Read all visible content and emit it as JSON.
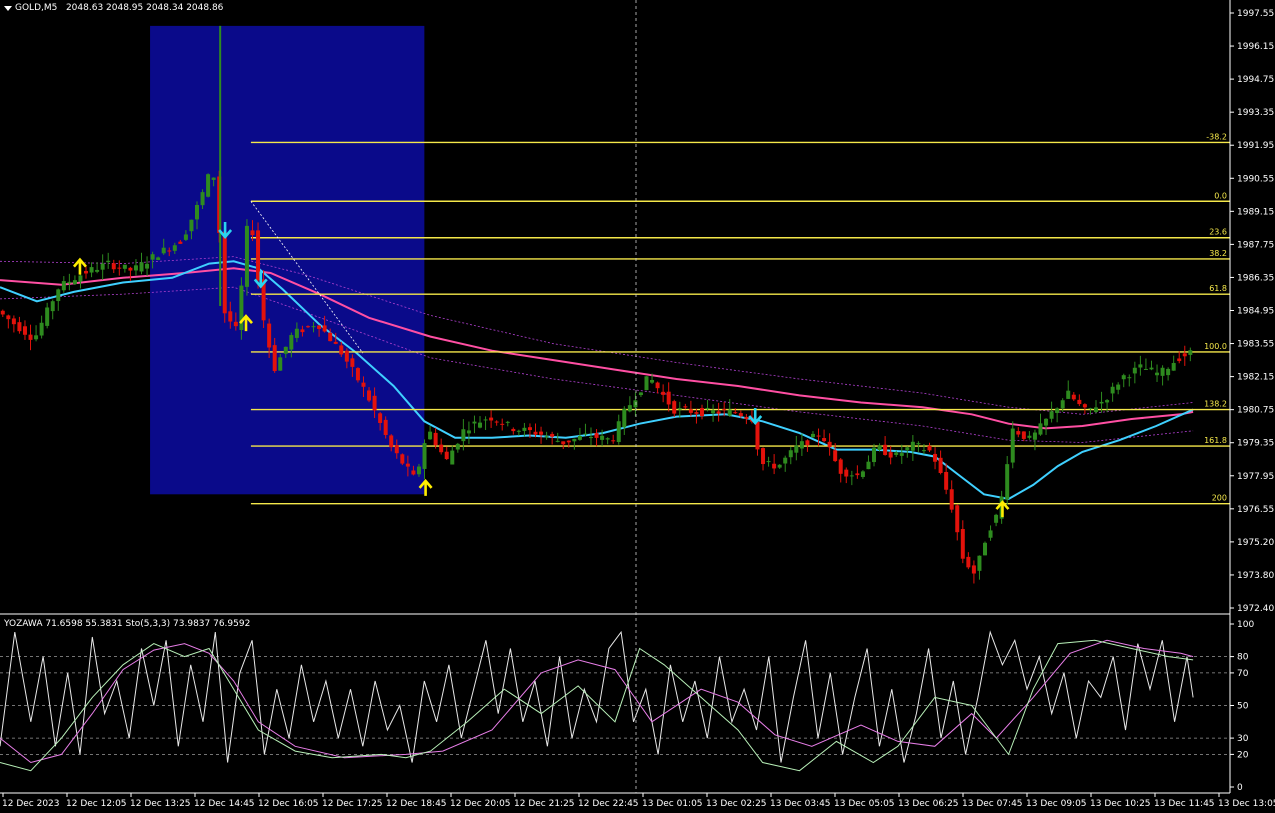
{
  "header": {
    "symbol": "GOLD,M5",
    "ohlc": "2048.63 2048.95 2048.34 2048.86"
  },
  "indicator_header": "YOZAWA 71.6598 55.3831  Sto(5,3,3) 73.9837 76.9592",
  "colors": {
    "background": "#000000",
    "bull": "#2e8b1f",
    "bear": "#e3120b",
    "zone": "#0a0a8a",
    "fib": "#f5e84a",
    "ma_fast": "#3fd0ff",
    "ma_slow": "#ff4fa3",
    "envelope": "#b040d0",
    "arrow_up": "#ffee00",
    "arrow_down": "#2ad4f0",
    "axis": "#ffffff",
    "stoch_main": "#b8f0b8",
    "stoch_signal": "#e87ee8",
    "yozawa": "#e8e8e8"
  },
  "price_axis": {
    "ticks": [
      "1997.55",
      "1996.15",
      "1994.75",
      "1993.35",
      "1991.95",
      "1990.55",
      "1989.15",
      "1987.75",
      "1986.35",
      "1984.95",
      "1983.55",
      "1982.15",
      "1980.75",
      "1979.35",
      "1977.95",
      "1976.55",
      "1975.20",
      "1973.80",
      "1972.40"
    ]
  },
  "time_axis": {
    "labels": [
      "12 Dec 2023",
      "12 Dec 12:05",
      "12 Dec 13:25",
      "12 Dec 14:45",
      "12 Dec 16:05",
      "12 Dec 17:25",
      "12 Dec 18:45",
      "12 Dec 20:05",
      "12 Dec 21:25",
      "12 Dec 22:45",
      "13 Dec 01:05",
      "13 Dec 02:25",
      "13 Dec 03:45",
      "13 Dec 05:05",
      "13 Dec 06:25",
      "13 Dec 07:45",
      "13 Dec 09:05",
      "13 Dec 10:25",
      "13 Dec 11:45",
      "13 Dec 13:05"
    ]
  },
  "indicator_axis": {
    "ticks": [
      "100",
      "80",
      "70",
      "50",
      "30",
      "20",
      "0"
    ]
  },
  "fibonacci": [
    {
      "label": "-38.2",
      "price": 1991.95
    },
    {
      "label": "0.0",
      "price": 1989.45
    },
    {
      "label": "23.6",
      "price": 1987.9
    },
    {
      "label": "38.2",
      "price": 1987.0
    },
    {
      "label": "61.8",
      "price": 1985.5
    },
    {
      "label": "100.0",
      "price": 1983.05
    },
    {
      "label": "138.2",
      "price": 1980.6
    },
    {
      "label": "161.8",
      "price": 1979.05
    },
    {
      "label": "200",
      "price": 1976.6
    }
  ],
  "chart_data": {
    "type": "bar",
    "symbol": "GOLD,M5",
    "ylim": [
      1972.0,
      1998.0
    ],
    "grid": false,
    "blue_zone": {
      "x_start": 0.122,
      "x_end": 0.345,
      "price_top": 1996.9,
      "price_bottom": 1977.0
    },
    "path_keypoints": [
      [
        0.0,
        1984.8
      ],
      [
        0.03,
        1983.6
      ],
      [
        0.05,
        1985.8
      ],
      [
        0.07,
        1986.4
      ],
      [
        0.09,
        1986.8
      ],
      [
        0.11,
        1986.5
      ],
      [
        0.13,
        1987.2
      ],
      [
        0.15,
        1987.8
      ],
      [
        0.165,
        1989.5
      ],
      [
        0.175,
        1991.0
      ],
      [
        0.18,
        1988.5
      ],
      [
        0.185,
        1984.7
      ],
      [
        0.195,
        1983.9
      ],
      [
        0.205,
        1989.3
      ],
      [
        0.215,
        1984.8
      ],
      [
        0.225,
        1982.3
      ],
      [
        0.24,
        1983.8
      ],
      [
        0.26,
        1984.3
      ],
      [
        0.28,
        1983.0
      ],
      [
        0.3,
        1981.3
      ],
      [
        0.32,
        1979.0
      ],
      [
        0.34,
        1977.6
      ],
      [
        0.35,
        1979.8
      ],
      [
        0.365,
        1978.4
      ],
      [
        0.38,
        1979.8
      ],
      [
        0.4,
        1980.3
      ],
      [
        0.42,
        1979.8
      ],
      [
        0.44,
        1979.6
      ],
      [
        0.46,
        1979.2
      ],
      [
        0.48,
        1979.5
      ],
      [
        0.5,
        1979.3
      ],
      [
        0.51,
        1980.5
      ],
      [
        0.53,
        1982.0
      ],
      [
        0.55,
        1980.6
      ],
      [
        0.57,
        1980.5
      ],
      [
        0.6,
        1980.5
      ],
      [
        0.615,
        1980.2
      ],
      [
        0.62,
        1978.3
      ],
      [
        0.635,
        1978.2
      ],
      [
        0.65,
        1979.0
      ],
      [
        0.67,
        1979.6
      ],
      [
        0.685,
        1978.0
      ],
      [
        0.7,
        1977.8
      ],
      [
        0.715,
        1979.0
      ],
      [
        0.73,
        1978.6
      ],
      [
        0.745,
        1979.1
      ],
      [
        0.76,
        1978.8
      ],
      [
        0.775,
        1976.7
      ],
      [
        0.785,
        1974.3
      ],
      [
        0.795,
        1973.6
      ],
      [
        0.805,
        1975.4
      ],
      [
        0.815,
        1976.3
      ],
      [
        0.825,
        1979.8
      ],
      [
        0.84,
        1979.3
      ],
      [
        0.855,
        1980.3
      ],
      [
        0.87,
        1981.3
      ],
      [
        0.885,
        1980.5
      ],
      [
        0.9,
        1981.0
      ],
      [
        0.915,
        1982.0
      ],
      [
        0.93,
        1982.4
      ],
      [
        0.945,
        1982.1
      ],
      [
        0.96,
        1982.8
      ],
      [
        0.97,
        1983.0
      ]
    ],
    "ma_fast_keypoints": [
      [
        0.0,
        1985.8
      ],
      [
        0.03,
        1985.2
      ],
      [
        0.06,
        1985.6
      ],
      [
        0.1,
        1986.0
      ],
      [
        0.14,
        1986.2
      ],
      [
        0.17,
        1986.8
      ],
      [
        0.19,
        1986.9
      ],
      [
        0.21,
        1986.6
      ],
      [
        0.23,
        1985.7
      ],
      [
        0.26,
        1984.2
      ],
      [
        0.29,
        1983.0
      ],
      [
        0.32,
        1981.6
      ],
      [
        0.345,
        1980.1
      ],
      [
        0.37,
        1979.4
      ],
      [
        0.4,
        1979.4
      ],
      [
        0.43,
        1979.5
      ],
      [
        0.46,
        1979.4
      ],
      [
        0.49,
        1979.6
      ],
      [
        0.52,
        1980.0
      ],
      [
        0.55,
        1980.3
      ],
      [
        0.59,
        1980.4
      ],
      [
        0.62,
        1980.1
      ],
      [
        0.65,
        1979.6
      ],
      [
        0.68,
        1978.9
      ],
      [
        0.71,
        1978.9
      ],
      [
        0.74,
        1978.8
      ],
      [
        0.76,
        1978.6
      ],
      [
        0.78,
        1977.8
      ],
      [
        0.8,
        1977.0
      ],
      [
        0.82,
        1976.8
      ],
      [
        0.84,
        1977.4
      ],
      [
        0.86,
        1978.2
      ],
      [
        0.88,
        1978.8
      ],
      [
        0.91,
        1979.3
      ],
      [
        0.94,
        1979.9
      ],
      [
        0.97,
        1980.6
      ]
    ],
    "ma_slow_keypoints": [
      [
        0.0,
        1986.1
      ],
      [
        0.05,
        1985.9
      ],
      [
        0.1,
        1986.2
      ],
      [
        0.15,
        1986.4
      ],
      [
        0.19,
        1986.6
      ],
      [
        0.22,
        1986.4
      ],
      [
        0.26,
        1985.5
      ],
      [
        0.3,
        1984.5
      ],
      [
        0.35,
        1983.7
      ],
      [
        0.4,
        1983.1
      ],
      [
        0.45,
        1982.7
      ],
      [
        0.5,
        1982.3
      ],
      [
        0.55,
        1981.9
      ],
      [
        0.6,
        1981.6
      ],
      [
        0.65,
        1981.2
      ],
      [
        0.7,
        1980.9
      ],
      [
        0.75,
        1980.7
      ],
      [
        0.79,
        1980.4
      ],
      [
        0.82,
        1980.0
      ],
      [
        0.85,
        1979.8
      ],
      [
        0.88,
        1979.9
      ],
      [
        0.92,
        1980.2
      ],
      [
        0.96,
        1980.4
      ],
      [
        0.97,
        1980.5
      ]
    ],
    "envelope_upper_keypoints": [
      [
        0.0,
        1986.9
      ],
      [
        0.1,
        1986.8
      ],
      [
        0.19,
        1987.1
      ],
      [
        0.25,
        1986.3
      ],
      [
        0.35,
        1984.6
      ],
      [
        0.45,
        1983.4
      ],
      [
        0.55,
        1982.6
      ],
      [
        0.65,
        1981.9
      ],
      [
        0.75,
        1981.3
      ],
      [
        0.82,
        1980.7
      ],
      [
        0.88,
        1980.4
      ],
      [
        0.97,
        1980.9
      ]
    ],
    "envelope_lower_keypoints": [
      [
        0.0,
        1985.3
      ],
      [
        0.1,
        1985.5
      ],
      [
        0.19,
        1985.8
      ],
      [
        0.25,
        1984.7
      ],
      [
        0.35,
        1982.8
      ],
      [
        0.45,
        1981.9
      ],
      [
        0.55,
        1981.2
      ],
      [
        0.65,
        1980.5
      ],
      [
        0.75,
        1979.9
      ],
      [
        0.82,
        1979.3
      ],
      [
        0.88,
        1979.2
      ],
      [
        0.97,
        1979.7
      ]
    ],
    "arrows": [
      {
        "type": "up",
        "x": 0.065,
        "price": 1986.8
      },
      {
        "type": "down",
        "x": 0.183,
        "price": 1988.1
      },
      {
        "type": "down",
        "x": 0.212,
        "price": 1986.0
      },
      {
        "type": "up",
        "x": 0.2,
        "price": 1984.4
      },
      {
        "type": "up",
        "x": 0.346,
        "price": 1977.4
      },
      {
        "type": "down",
        "x": 0.614,
        "price": 1980.2
      },
      {
        "type": "up",
        "x": 0.815,
        "price": 1976.5
      }
    ],
    "indicator": {
      "ylim": [
        0,
        100
      ],
      "levels": [
        80,
        70,
        50,
        30,
        20
      ],
      "stoch_main_keypoints": [
        [
          0.0,
          15
        ],
        [
          0.025,
          10
        ],
        [
          0.05,
          30
        ],
        [
          0.075,
          55
        ],
        [
          0.1,
          75
        ],
        [
          0.125,
          88
        ],
        [
          0.15,
          80
        ],
        [
          0.17,
          85
        ],
        [
          0.19,
          60
        ],
        [
          0.21,
          35
        ],
        [
          0.24,
          22
        ],
        [
          0.27,
          18
        ],
        [
          0.31,
          20
        ],
        [
          0.33,
          18
        ],
        [
          0.35,
          22
        ],
        [
          0.38,
          40
        ],
        [
          0.41,
          60
        ],
        [
          0.44,
          45
        ],
        [
          0.47,
          62
        ],
        [
          0.5,
          40
        ],
        [
          0.52,
          85
        ],
        [
          0.54,
          75
        ],
        [
          0.57,
          55
        ],
        [
          0.6,
          35
        ],
        [
          0.62,
          15
        ],
        [
          0.65,
          10
        ],
        [
          0.68,
          28
        ],
        [
          0.71,
          15
        ],
        [
          0.73,
          25
        ],
        [
          0.76,
          55
        ],
        [
          0.79,
          50
        ],
        [
          0.82,
          20
        ],
        [
          0.84,
          60
        ],
        [
          0.86,
          88
        ],
        [
          0.89,
          90
        ],
        [
          0.92,
          85
        ],
        [
          0.95,
          80
        ],
        [
          0.97,
          78
        ]
      ],
      "stoch_signal_keypoints": [
        [
          0.0,
          30
        ],
        [
          0.025,
          15
        ],
        [
          0.05,
          20
        ],
        [
          0.075,
          45
        ],
        [
          0.1,
          72
        ],
        [
          0.125,
          84
        ],
        [
          0.15,
          88
        ],
        [
          0.17,
          82
        ],
        [
          0.19,
          65
        ],
        [
          0.21,
          40
        ],
        [
          0.24,
          25
        ],
        [
          0.28,
          18
        ],
        [
          0.33,
          20
        ],
        [
          0.36,
          22
        ],
        [
          0.4,
          35
        ],
        [
          0.44,
          70
        ],
        [
          0.47,
          78
        ],
        [
          0.5,
          72
        ],
        [
          0.53,
          40
        ],
        [
          0.57,
          60
        ],
        [
          0.6,
          52
        ],
        [
          0.63,
          32
        ],
        [
          0.66,
          25
        ],
        [
          0.7,
          38
        ],
        [
          0.73,
          28
        ],
        [
          0.76,
          25
        ],
        [
          0.79,
          45
        ],
        [
          0.81,
          30
        ],
        [
          0.84,
          55
        ],
        [
          0.87,
          82
        ],
        [
          0.9,
          90
        ],
        [
          0.93,
          85
        ],
        [
          0.96,
          82
        ],
        [
          0.97,
          80
        ]
      ],
      "yozawa_keypoints": [
        [
          0.0,
          25
        ],
        [
          0.012,
          95
        ],
        [
          0.025,
          40
        ],
        [
          0.035,
          80
        ],
        [
          0.045,
          25
        ],
        [
          0.055,
          70
        ],
        [
          0.065,
          20
        ],
        [
          0.075,
          92
        ],
        [
          0.085,
          45
        ],
        [
          0.095,
          65
        ],
        [
          0.105,
          30
        ],
        [
          0.115,
          85
        ],
        [
          0.125,
          50
        ],
        [
          0.135,
          90
        ],
        [
          0.145,
          25
        ],
        [
          0.155,
          75
        ],
        [
          0.165,
          40
        ],
        [
          0.175,
          95
        ],
        [
          0.185,
          15
        ],
        [
          0.195,
          70
        ],
        [
          0.205,
          90
        ],
        [
          0.215,
          20
        ],
        [
          0.225,
          60
        ],
        [
          0.235,
          30
        ],
        [
          0.245,
          75
        ],
        [
          0.255,
          40
        ],
        [
          0.265,
          65
        ],
        [
          0.275,
          30
        ],
        [
          0.285,
          60
        ],
        [
          0.295,
          25
        ],
        [
          0.305,
          65
        ],
        [
          0.315,
          35
        ],
        [
          0.325,
          50
        ],
        [
          0.335,
          15
        ],
        [
          0.345,
          65
        ],
        [
          0.355,
          40
        ],
        [
          0.365,
          75
        ],
        [
          0.375,
          30
        ],
        [
          0.385,
          60
        ],
        [
          0.395,
          90
        ],
        [
          0.405,
          45
        ],
        [
          0.415,
          85
        ],
        [
          0.425,
          40
        ],
        [
          0.435,
          65
        ],
        [
          0.445,
          25
        ],
        [
          0.455,
          80
        ],
        [
          0.465,
          30
        ],
        [
          0.475,
          60
        ],
        [
          0.485,
          40
        ],
        [
          0.495,
          85
        ],
        [
          0.505,
          95
        ],
        [
          0.515,
          40
        ],
        [
          0.525,
          60
        ],
        [
          0.535,
          20
        ],
        [
          0.545,
          75
        ],
        [
          0.555,
          40
        ],
        [
          0.565,
          65
        ],
        [
          0.575,
          30
        ],
        [
          0.585,
          80
        ],
        [
          0.595,
          40
        ],
        [
          0.605,
          60
        ],
        [
          0.615,
          35
        ],
        [
          0.625,
          80
        ],
        [
          0.635,
          15
        ],
        [
          0.645,
          55
        ],
        [
          0.655,
          90
        ],
        [
          0.665,
          30
        ],
        [
          0.675,
          70
        ],
        [
          0.685,
          20
        ],
        [
          0.695,
          55
        ],
        [
          0.705,
          85
        ],
        [
          0.715,
          25
        ],
        [
          0.725,
          60
        ],
        [
          0.735,
          15
        ],
        [
          0.745,
          45
        ],
        [
          0.755,
          85
        ],
        [
          0.765,
          30
        ],
        [
          0.775,
          65
        ],
        [
          0.785,
          20
        ],
        [
          0.795,
          55
        ],
        [
          0.805,
          95
        ],
        [
          0.815,
          75
        ],
        [
          0.825,
          90
        ],
        [
          0.835,
          60
        ],
        [
          0.845,
          80
        ],
        [
          0.855,
          45
        ],
        [
          0.865,
          70
        ],
        [
          0.875,
          30
        ],
        [
          0.885,
          65
        ],
        [
          0.895,
          55
        ],
        [
          0.905,
          80
        ],
        [
          0.915,
          35
        ],
        [
          0.925,
          88
        ],
        [
          0.935,
          60
        ],
        [
          0.945,
          90
        ],
        [
          0.955,
          40
        ],
        [
          0.965,
          80
        ],
        [
          0.97,
          55
        ]
      ]
    }
  }
}
